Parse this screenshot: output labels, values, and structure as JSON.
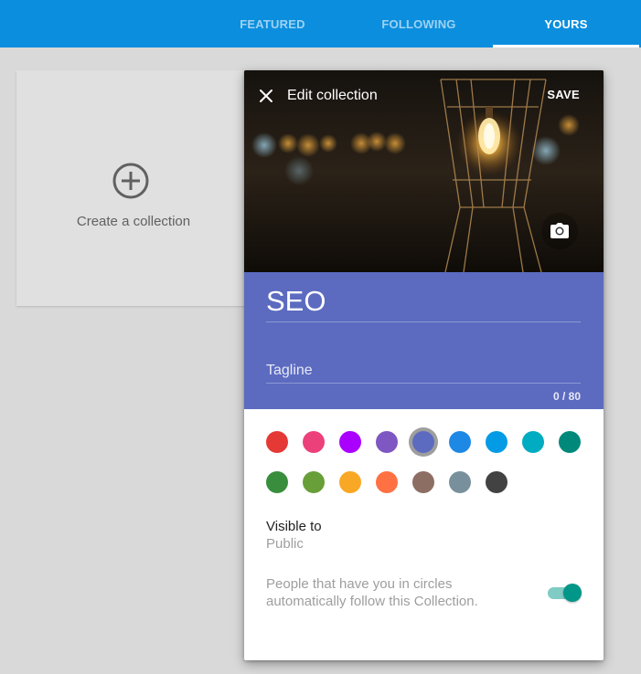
{
  "tabs": [
    {
      "label": "FEATURED",
      "active": false
    },
    {
      "label": "FOLLOWING",
      "active": false
    },
    {
      "label": "YOURS",
      "active": true
    }
  ],
  "create_card": {
    "label": "Create a collection",
    "icon": "add-circle-icon"
  },
  "dialog": {
    "title": "Edit collection",
    "save_label": "SAVE",
    "collection_name": "SEO",
    "tagline_placeholder": "Tagline",
    "tagline_value": "",
    "counter": "0 / 80",
    "selected_color": "#5c6bc0",
    "colors": [
      "#e53935",
      "#ec407a",
      "#aa00ff",
      "#7e57c2",
      "#5c6bc0",
      "#1e88e5",
      "#039be5",
      "#00acc1",
      "#00897b",
      "#388e3c",
      "#689f38",
      "#f9a825",
      "#ff7043",
      "#8d6e63",
      "#78909c",
      "#424242"
    ],
    "visible_label": "Visible to",
    "visible_value": "Public",
    "follow_text": "People that have you in circles automatically follow this Collection.",
    "follow_enabled": true
  },
  "colors": {
    "topbar": "#0b8ede",
    "page_background": "#d9d9d9",
    "title_area": "#5c6bc0",
    "toggle_thumb": "#009688"
  }
}
